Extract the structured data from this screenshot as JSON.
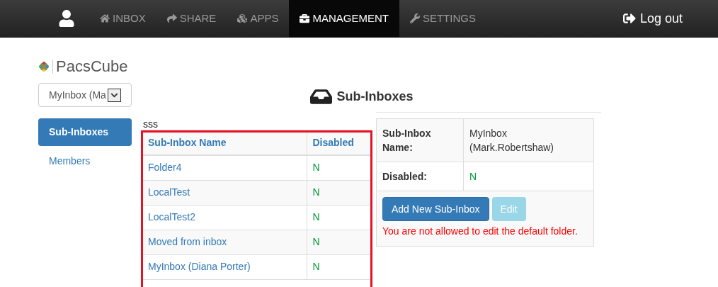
{
  "nav": {
    "items": [
      {
        "label": "INBOX",
        "selected": false
      },
      {
        "label": "SHARE",
        "selected": false
      },
      {
        "label": "APPS",
        "selected": false
      },
      {
        "label": "MANAGEMENT",
        "selected": true
      },
      {
        "label": "SETTINGS",
        "selected": false
      }
    ],
    "logout": "Log out"
  },
  "logo": "PacsCube",
  "inbox_select": {
    "value": "MyInbox (Ma"
  },
  "sidebar": {
    "items": [
      {
        "label": "Sub-Inboxes",
        "selected": true
      },
      {
        "label": "Members",
        "selected": false
      }
    ]
  },
  "heading": "Sub-Inboxes",
  "note": "sss",
  "table": {
    "columns": [
      "Sub-Inbox Name",
      "Disabled"
    ],
    "rows": [
      [
        "Folder4",
        "N"
      ],
      [
        "LocalTest",
        "N"
      ],
      [
        "LocalTest2",
        "N"
      ],
      [
        "Moved from inbox",
        "N"
      ],
      [
        "MyInbox (Diana Porter)",
        "N"
      ]
    ]
  },
  "details": {
    "fields": [
      {
        "label": "Sub-Inbox Name:",
        "value": "MyInbox (Mark.Robertshaw)"
      },
      {
        "label": "Disabled:",
        "value": "N"
      }
    ],
    "buttons": [
      {
        "label": "Add New Sub-Inbox",
        "disabled": false
      },
      {
        "label": "Edit",
        "disabled": true
      }
    ],
    "error": "You are not allowed to edit the default folder."
  }
}
